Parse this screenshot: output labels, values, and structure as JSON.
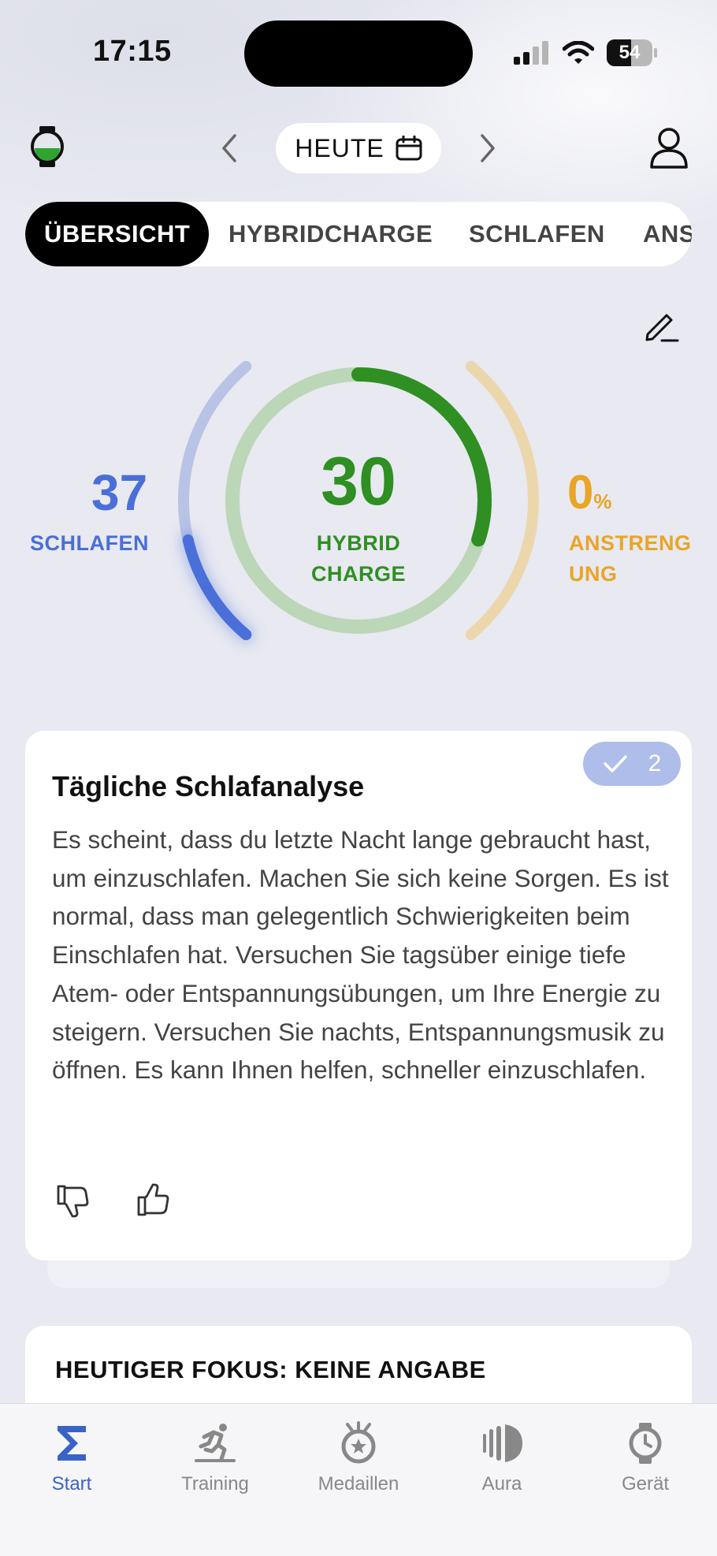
{
  "status_bar": {
    "time": "17:15",
    "battery": "54",
    "battery_level": 0.54
  },
  "header": {
    "date_label": "HEUTE",
    "prev_icon": "chevron-left-icon",
    "next_icon": "chevron-right-icon"
  },
  "tabs": [
    {
      "label": "ÜBERSICHT",
      "active": true
    },
    {
      "label": "HYBRIDCHARGE",
      "active": false
    },
    {
      "label": "SCHLAFEN",
      "active": false
    },
    {
      "label": "ANS",
      "active": false
    }
  ],
  "metrics": {
    "sleep": {
      "value": "37",
      "label": "SCHLAFEN",
      "color": "#4a6fd8",
      "level": 0.37
    },
    "hybrid": {
      "value": "30",
      "label_line1": "HYBRID",
      "label_line2": "CHARGE",
      "color": "#2f8f22",
      "level": 0.3
    },
    "exertion": {
      "value": "0",
      "unit": "%",
      "label_line1": "ANSTRENG",
      "label_line2": "UNG",
      "color": "#eaa524",
      "level": 0.0
    }
  },
  "analysis_card": {
    "title": "Tägliche Schlafanalyse",
    "badge_count": "2",
    "body": "Es scheint, dass du letzte Nacht lange gebraucht hast, um einzuschlafen. Machen Sie sich keine Sorgen. Es ist normal, dass man gelegentlich Schwierigkeiten beim Einschlafen hat. Versuchen Sie tagsüber einige tiefe Atem- oder Entspannungsübungen, um Ihre Energie zu steigern. Versuchen Sie nachts, Entspannungsmusik zu öffnen. Es kann Ihnen helfen, schneller einzuschlafen."
  },
  "focus_card": {
    "title": "HEUTIGER FOKUS: KEINE ANGABE"
  },
  "nav": [
    {
      "label": "Start",
      "icon": "sigma-icon",
      "active": true
    },
    {
      "label": "Training",
      "icon": "runner-icon",
      "active": false
    },
    {
      "label": "Medaillen",
      "icon": "medal-icon",
      "active": false
    },
    {
      "label": "Aura",
      "icon": "aura-icon",
      "active": false
    },
    {
      "label": "Gerät",
      "icon": "watch-icon",
      "active": false
    }
  ],
  "colors": {
    "accent": "#3a63c8",
    "background": "#e8e9f1"
  }
}
